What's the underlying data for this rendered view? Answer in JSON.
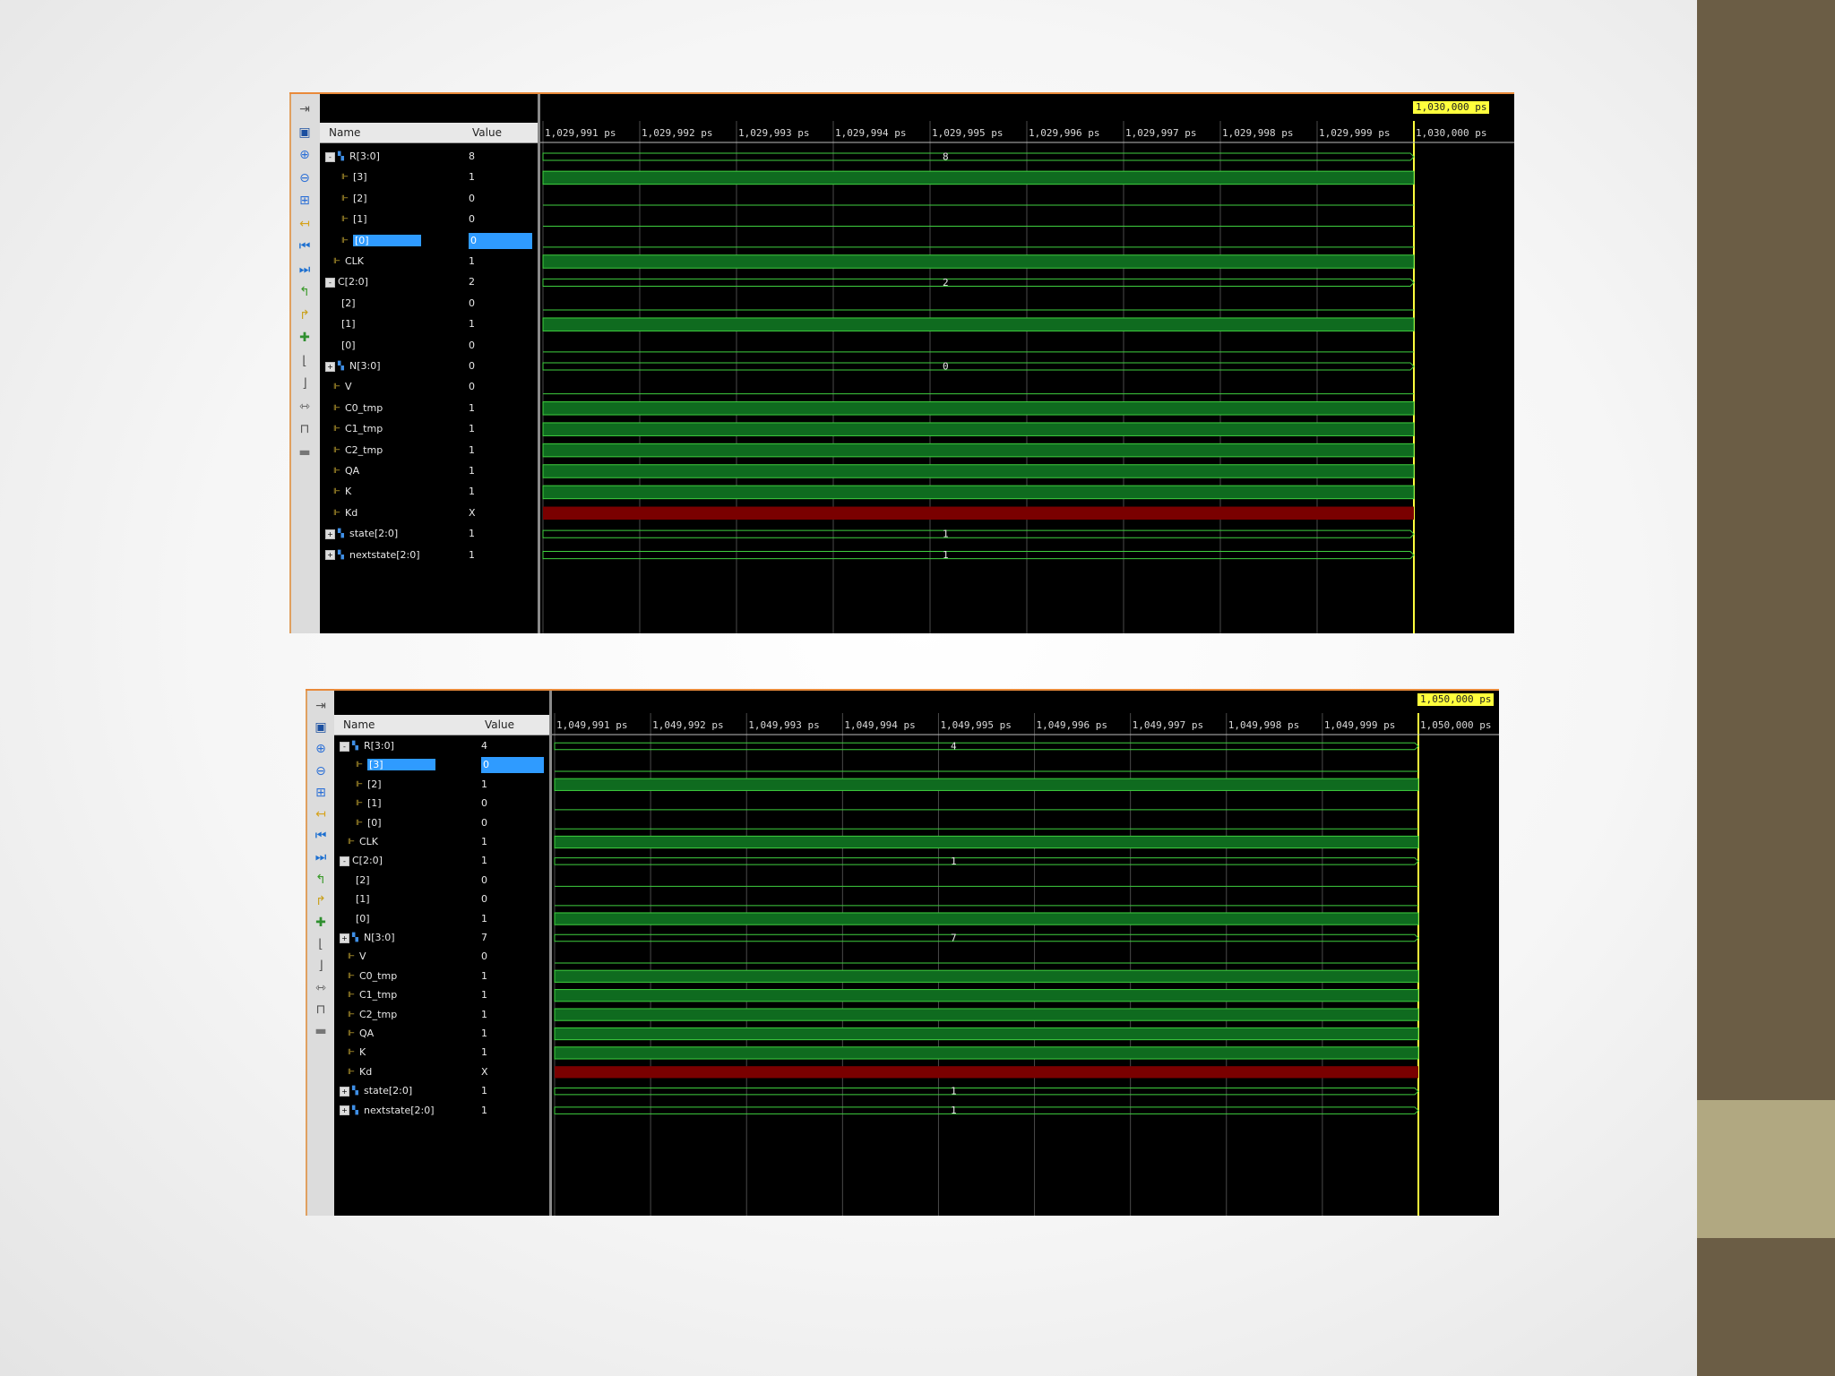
{
  "columns": {
    "name": "Name",
    "value": "Value"
  },
  "colors": {
    "wave_high": "#0f6b1f",
    "wave_line": "#3fcf3f",
    "wave_unknown": "#7a0000",
    "cursor": "#ffff3c",
    "selection": "#2f9bff",
    "grid": "#4a4a4a"
  },
  "toolbar_icons": [
    "zoom-fit-icon",
    "save-icon",
    "zoom-in-icon",
    "zoom-out-icon",
    "zoom-full-icon",
    "cursor-icon",
    "go-start-icon",
    "go-end-icon",
    "prev-transition-icon",
    "next-transition-icon",
    "add-marker-icon",
    "prev-marker-icon",
    "next-marker-icon",
    "swap-cursors-icon",
    "snap-icon",
    "lock-icon"
  ],
  "windows": [
    {
      "cursor_time": "1,030,000 ps",
      "time_labels": [
        "1,029,991 ps",
        "1,029,992 ps",
        "1,029,993 ps",
        "1,029,994 ps",
        "1,029,995 ps",
        "1,029,996 ps",
        "1,029,997 ps",
        "1,029,998 ps",
        "1,029,999 ps",
        "1,030,000 ps"
      ],
      "signals": [
        {
          "name": "R[3:0]",
          "value": "8",
          "type": "bus",
          "expander": "-",
          "indent": 0
        },
        {
          "name": "[3]",
          "value": "1",
          "type": "bit",
          "indent": 2
        },
        {
          "name": "[2]",
          "value": "0",
          "type": "bit",
          "indent": 2
        },
        {
          "name": "[1]",
          "value": "0",
          "type": "bit",
          "indent": 2
        },
        {
          "name": "[0]",
          "value": "0",
          "type": "bit",
          "indent": 2,
          "selected": true
        },
        {
          "name": "CLK",
          "value": "1",
          "type": "bit",
          "indent": 1
        },
        {
          "name": "C[2:0]",
          "value": "2",
          "type": "bus",
          "expander": "-",
          "indent": 0,
          "noicon": true
        },
        {
          "name": "[2]",
          "value": "0",
          "type": "bit",
          "indent": 2,
          "noicon": true
        },
        {
          "name": "[1]",
          "value": "1",
          "type": "bit",
          "indent": 2,
          "noicon": true
        },
        {
          "name": "[0]",
          "value": "0",
          "type": "bit",
          "indent": 2,
          "noicon": true
        },
        {
          "name": "N[3:0]",
          "value": "0",
          "type": "bus",
          "expander": "+",
          "indent": 0
        },
        {
          "name": "V",
          "value": "0",
          "type": "bit",
          "indent": 1
        },
        {
          "name": "C0_tmp",
          "value": "1",
          "type": "bit",
          "indent": 1
        },
        {
          "name": "C1_tmp",
          "value": "1",
          "type": "bit",
          "indent": 1
        },
        {
          "name": "C2_tmp",
          "value": "1",
          "type": "bit",
          "indent": 1
        },
        {
          "name": "QA",
          "value": "1",
          "type": "bit",
          "indent": 1
        },
        {
          "name": "K",
          "value": "1",
          "type": "bit",
          "indent": 1
        },
        {
          "name": "Kd",
          "value": "X",
          "type": "bit",
          "indent": 1
        },
        {
          "name": "state[2:0]",
          "value": "1",
          "type": "bus",
          "expander": "+",
          "indent": 0
        },
        {
          "name": "nextstate[2:0]",
          "value": "1",
          "type": "bus",
          "expander": "+",
          "indent": 0
        }
      ]
    },
    {
      "cursor_time": "1,050,000 ps",
      "time_labels": [
        "1,049,991 ps",
        "1,049,992 ps",
        "1,049,993 ps",
        "1,049,994 ps",
        "1,049,995 ps",
        "1,049,996 ps",
        "1,049,997 ps",
        "1,049,998 ps",
        "1,049,999 ps",
        "1,050,000 ps"
      ],
      "signals": [
        {
          "name": "R[3:0]",
          "value": "4",
          "type": "bus",
          "expander": "-",
          "indent": 0
        },
        {
          "name": "[3]",
          "value": "0",
          "type": "bit",
          "indent": 2,
          "selected": true
        },
        {
          "name": "[2]",
          "value": "1",
          "type": "bit",
          "indent": 2
        },
        {
          "name": "[1]",
          "value": "0",
          "type": "bit",
          "indent": 2
        },
        {
          "name": "[0]",
          "value": "0",
          "type": "bit",
          "indent": 2
        },
        {
          "name": "CLK",
          "value": "1",
          "type": "bit",
          "indent": 1
        },
        {
          "name": "C[2:0]",
          "value": "1",
          "type": "bus",
          "expander": "-",
          "indent": 0,
          "noicon": true
        },
        {
          "name": "[2]",
          "value": "0",
          "type": "bit",
          "indent": 2,
          "noicon": true
        },
        {
          "name": "[1]",
          "value": "0",
          "type": "bit",
          "indent": 2,
          "noicon": true
        },
        {
          "name": "[0]",
          "value": "1",
          "type": "bit",
          "indent": 2,
          "noicon": true
        },
        {
          "name": "N[3:0]",
          "value": "7",
          "type": "bus",
          "expander": "+",
          "indent": 0
        },
        {
          "name": "V",
          "value": "0",
          "type": "bit",
          "indent": 1
        },
        {
          "name": "C0_tmp",
          "value": "1",
          "type": "bit",
          "indent": 1
        },
        {
          "name": "C1_tmp",
          "value": "1",
          "type": "bit",
          "indent": 1
        },
        {
          "name": "C2_tmp",
          "value": "1",
          "type": "bit",
          "indent": 1
        },
        {
          "name": "QA",
          "value": "1",
          "type": "bit",
          "indent": 1
        },
        {
          "name": "K",
          "value": "1",
          "type": "bit",
          "indent": 1
        },
        {
          "name": "Kd",
          "value": "X",
          "type": "bit",
          "indent": 1
        },
        {
          "name": "state[2:0]",
          "value": "1",
          "type": "bus",
          "expander": "+",
          "indent": 0
        },
        {
          "name": "nextstate[2:0]",
          "value": "1",
          "type": "bus",
          "expander": "+",
          "indent": 0
        }
      ]
    }
  ]
}
